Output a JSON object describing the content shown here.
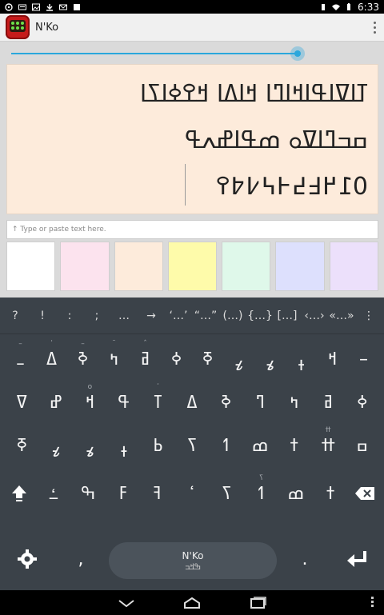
{
  "status": {
    "time": "6:33"
  },
  "app": {
    "title": "N'Ko"
  },
  "display": {
    "lines": [
      "ߠߊߜߊߟߊߞߊߣߊ ߞߊߡߊ ߞߐߦߊߖߊ",
      "ߛߏߣߊߜߋ ߘߟߊߝߍߟ",
      "߀߁߂߃߄߅߆߇߈߉"
    ]
  },
  "input": {
    "placeholder": "↑ Type or paste text here."
  },
  "swatches": [
    {
      "name": "white",
      "color": "#ffffff"
    },
    {
      "name": "pink",
      "color": "#fce3ee"
    },
    {
      "name": "peach",
      "color": "#fdebdb"
    },
    {
      "name": "yellow",
      "color": "#fefbaa"
    },
    {
      "name": "mint",
      "color": "#dff8ea"
    },
    {
      "name": "lavender",
      "color": "#dde0fd"
    },
    {
      "name": "lilac",
      "color": "#ece0fb"
    }
  ],
  "keyboard": {
    "suggestions": [
      "?",
      "!",
      ":",
      ";",
      "…",
      "→",
      "‘…’",
      "“…”",
      "(…)",
      "{…}",
      "[…]",
      "‹…›",
      "«…»",
      "⋮"
    ],
    "row1": [
      {
        "c": "ߺ",
        "h": "–"
      },
      {
        "c": "ߡ",
        "h": "ߵ"
      },
      {
        "c": "ߢ",
        "h": "–"
      },
      {
        "c": "ߤ",
        "h": "¨"
      },
      {
        "c": "ߥ",
        "h": "ˆ"
      },
      {
        "c": "ߦ",
        "h": ""
      },
      {
        "c": "ߧ",
        "h": ""
      },
      {
        "c": "ߨ",
        "h": ""
      },
      {
        "c": "ߩ",
        "h": ""
      },
      {
        "c": "ߪ",
        "h": ""
      },
      {
        "c": "ߞ",
        "h": ""
      },
      {
        "c": "–",
        "h": ""
      }
    ],
    "row2": [
      {
        "c": "ߜ",
        "h": ""
      },
      {
        "c": "ߝ",
        "h": ""
      },
      {
        "c": "ߞ",
        "h": "o"
      },
      {
        "c": "ߟ",
        "h": ""
      },
      {
        "c": "ߠ",
        "h": "ߵ"
      },
      {
        "c": "ߡ",
        "h": ""
      },
      {
        "c": "ߢ",
        "h": ""
      },
      {
        "c": "ߣ",
        "h": ""
      },
      {
        "c": "ߤ",
        "h": ""
      },
      {
        "c": "ߥ",
        "h": ""
      },
      {
        "c": "ߦ",
        "h": ""
      }
    ],
    "row3": [
      {
        "c": "ߧ",
        "h": ""
      },
      {
        "c": "ߨ",
        "h": ""
      },
      {
        "c": "ߩ",
        "h": ""
      },
      {
        "c": "ߪ",
        "h": ""
      },
      {
        "c": "ߕ",
        "h": ""
      },
      {
        "c": "ߖ",
        "h": ""
      },
      {
        "c": "ߗ",
        "h": ""
      },
      {
        "c": "ߘ",
        "h": ""
      },
      {
        "c": "ߙ",
        "h": ""
      },
      {
        "c": "ߚ",
        "h": "ߚ"
      },
      {
        "c": "ߛ",
        "h": ""
      }
    ],
    "row4": [
      {
        "c": "ߑ",
        "h": ""
      },
      {
        "c": "ߒ",
        "h": ""
      },
      {
        "c": "ߓ",
        "h": ""
      },
      {
        "c": "ߔ",
        "h": ""
      },
      {
        "c": "ߵ",
        "h": ""
      },
      {
        "c": "ߖ",
        "h": ""
      },
      {
        "c": "ߗ",
        "h": "ߖ"
      },
      {
        "c": "ߘ",
        "h": ""
      },
      {
        "c": "ߙ",
        "h": ""
      }
    ],
    "row5": [
      ",",
      "،",
      "."
    ],
    "space": {
      "label": "N'Ko",
      "sublabel": "ߒߞߏ"
    }
  }
}
